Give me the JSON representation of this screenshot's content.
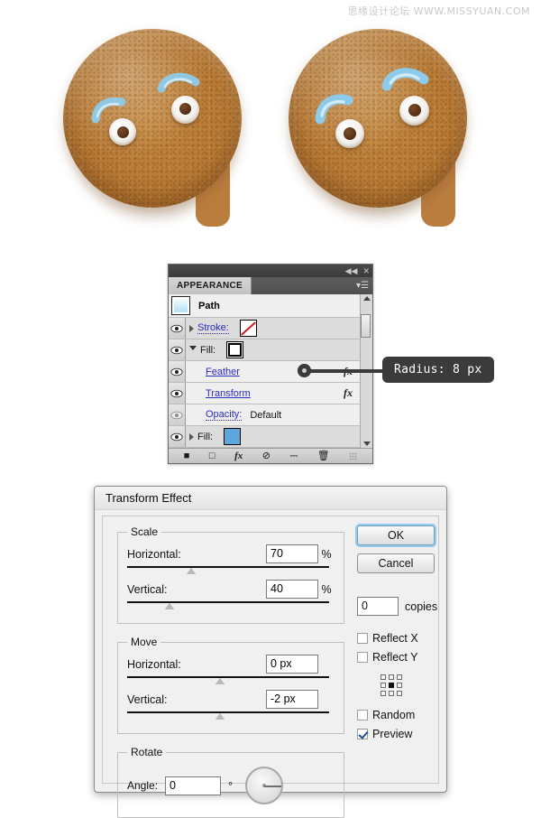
{
  "watermark": "思缘设计论坛  WWW.MISSYUAN.COM",
  "illustration": {
    "cookie_left_name": "gingerbread-cookie-before",
    "cookie_right_name": "gingerbread-cookie-after",
    "cookie_color": "#b87a35",
    "icing_color": "#8ecbea",
    "eye_white": "#f3f1ec",
    "pupil_color": "#5a3318"
  },
  "appearance_panel": {
    "tab_label": "APPEARANCE",
    "collapse_icon": "collapse-double-arrow-icon",
    "close_icon": "close-icon",
    "menu_icon": "panel-menu-icon",
    "target_label": "Path",
    "rows": [
      {
        "name": "stroke",
        "label": "Stroke:",
        "link": true,
        "disclosure": "right",
        "swatch": "none",
        "indent": 0,
        "fx": ""
      },
      {
        "name": "fill-white",
        "label": "Fill:",
        "link": true,
        "disclosure": "down",
        "swatch": "white",
        "indent": 0,
        "fx": ""
      },
      {
        "name": "feather",
        "label": "Feather",
        "link": true,
        "disclosure": "",
        "swatch": "",
        "indent": 1,
        "fx": "fx"
      },
      {
        "name": "transform",
        "label": "Transform",
        "link": true,
        "disclosure": "",
        "swatch": "",
        "indent": 1,
        "fx": "fx"
      },
      {
        "name": "opacity",
        "label": "Opacity:",
        "value": "Default",
        "link": true,
        "disclosure": "",
        "swatch": "",
        "indent": 1,
        "fx": ""
      },
      {
        "name": "fill-blue",
        "label": "Fill:",
        "link": false,
        "disclosure": "right",
        "swatch": "blue",
        "indent": 0,
        "fx": ""
      }
    ],
    "footer_icons": [
      "add-new-stroke-icon",
      "add-new-fill-icon",
      "add-new-effect-icon",
      "clear-appearance-icon",
      "duplicate-item-icon",
      "delete-item-icon"
    ]
  },
  "callout": {
    "text": "Radius: 8 px"
  },
  "transform_dialog": {
    "title": "Transform Effect",
    "groups": {
      "scale": {
        "legend": "Scale",
        "horizontal_label": "Horizontal:",
        "horizontal_value": "70",
        "horizontal_unit": "%",
        "vertical_label": "Vertical:",
        "vertical_value": "40",
        "vertical_unit": "%"
      },
      "move": {
        "legend": "Move",
        "horizontal_label": "Horizontal:",
        "horizontal_value": "0 px",
        "vertical_label": "Vertical:",
        "vertical_value": "-2 px"
      },
      "rotate": {
        "legend": "Rotate",
        "angle_label": "Angle:",
        "angle_value": "0",
        "degree_symbol": "°"
      }
    },
    "buttons": {
      "ok": "OK",
      "cancel": "Cancel"
    },
    "copies": {
      "value": "0",
      "label": "copies"
    },
    "checkboxes": [
      {
        "name": "reflect-x",
        "label": "Reflect X",
        "checked": false
      },
      {
        "name": "reflect-y",
        "label": "Reflect Y",
        "checked": false
      },
      {
        "name": "random",
        "label": "Random",
        "checked": false
      },
      {
        "name": "preview",
        "label": "Preview",
        "checked": true
      }
    ],
    "anchor_widget": {
      "name": "reference-point-selector",
      "selected": "center"
    }
  }
}
